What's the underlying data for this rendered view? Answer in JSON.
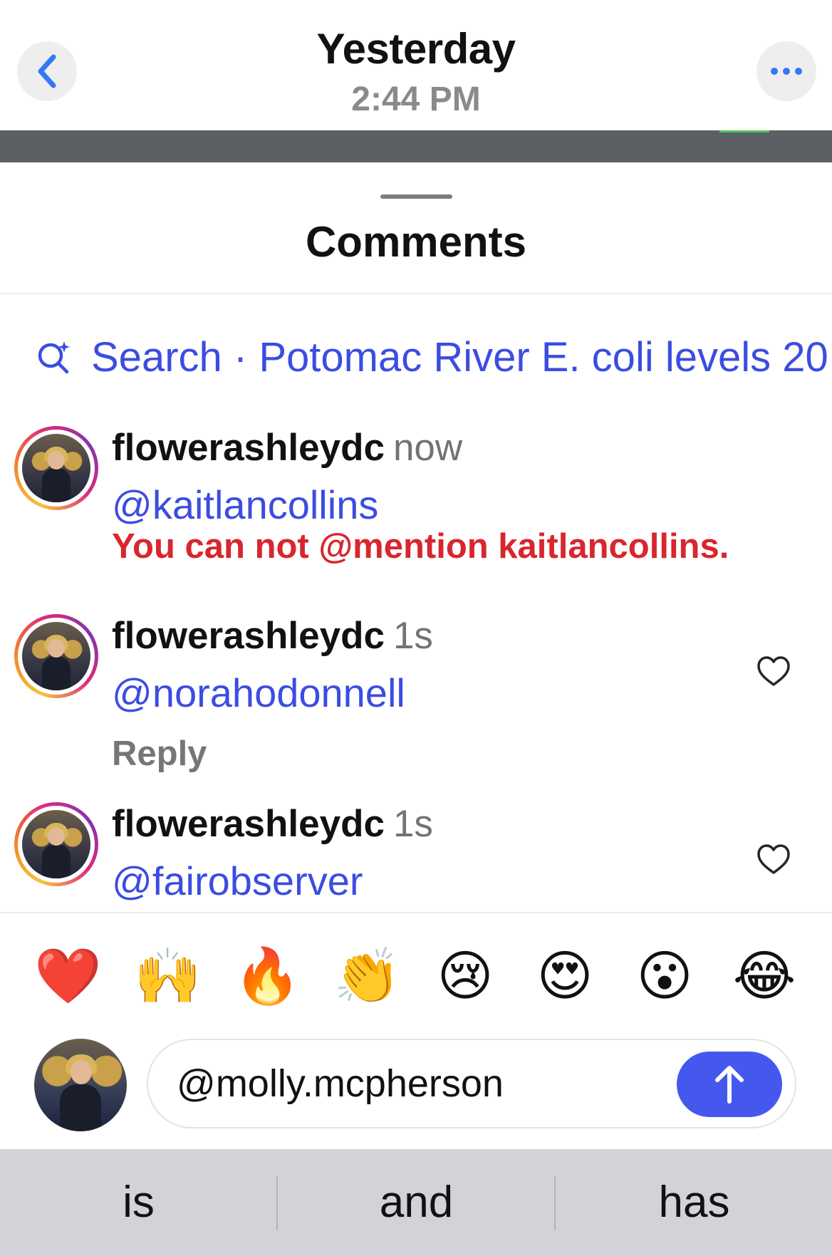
{
  "header": {
    "title": "Yesterday",
    "subtitle": "2:44 PM"
  },
  "sheet": {
    "title": "Comments"
  },
  "search": {
    "text": "Search · Potomac River E. coli levels 20"
  },
  "comments": [
    {
      "username": "flowerashleydc",
      "time": "now",
      "mention": "@kaitlancollins",
      "error": "You can not @mention kaitlancollins."
    },
    {
      "username": "flowerashleydc",
      "time": "1s",
      "mention": "@norahodonnell",
      "reply": "Reply"
    },
    {
      "username": "flowerashleydc",
      "time": "1s",
      "mention": "@fairobserver"
    }
  ],
  "emoji_bar": [
    "❤️",
    "🙌",
    "🔥",
    "👏",
    "😢",
    "😍",
    "😮",
    "😂"
  ],
  "composer": {
    "value": "@molly.mcpherson"
  },
  "keyboard_suggestions": [
    "is",
    "and",
    "has"
  ],
  "colors": {
    "link_blue": "#3b4de0",
    "error_red": "#d8262d",
    "send_blue": "#4558ee",
    "ios_blue": "#3478f6"
  }
}
